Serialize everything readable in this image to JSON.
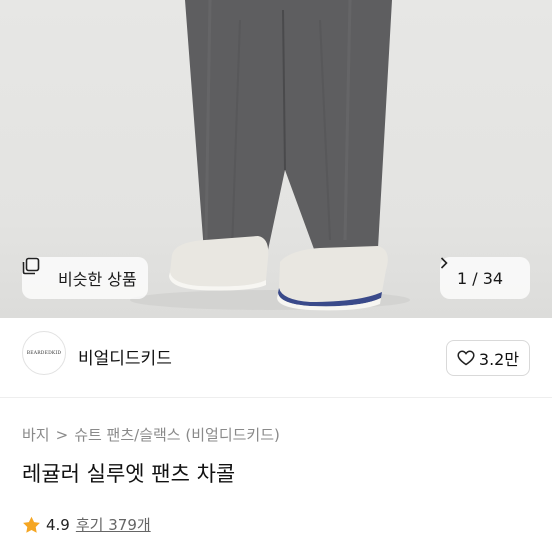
{
  "gallery": {
    "similar_label": "비슷한 상품",
    "pager_current": "1",
    "pager_total": "34",
    "pager_sep": " / "
  },
  "seller": {
    "logo_text": "BEARDEDKID",
    "name": "비얼디드키드",
    "likes": "3.2만"
  },
  "breadcrumb": {
    "items": [
      "바지",
      "슈트 팬츠/슬랙스 (비얼디드키드)"
    ],
    "separator": ">"
  },
  "product": {
    "title": "레귤러 실루엣 팬츠 차콜"
  },
  "rating": {
    "score": "4.9",
    "reviews": "후기 379개"
  },
  "colors": {
    "star": "#f5a623",
    "pants": "#5e5e60",
    "background": "#e5e5e3"
  }
}
